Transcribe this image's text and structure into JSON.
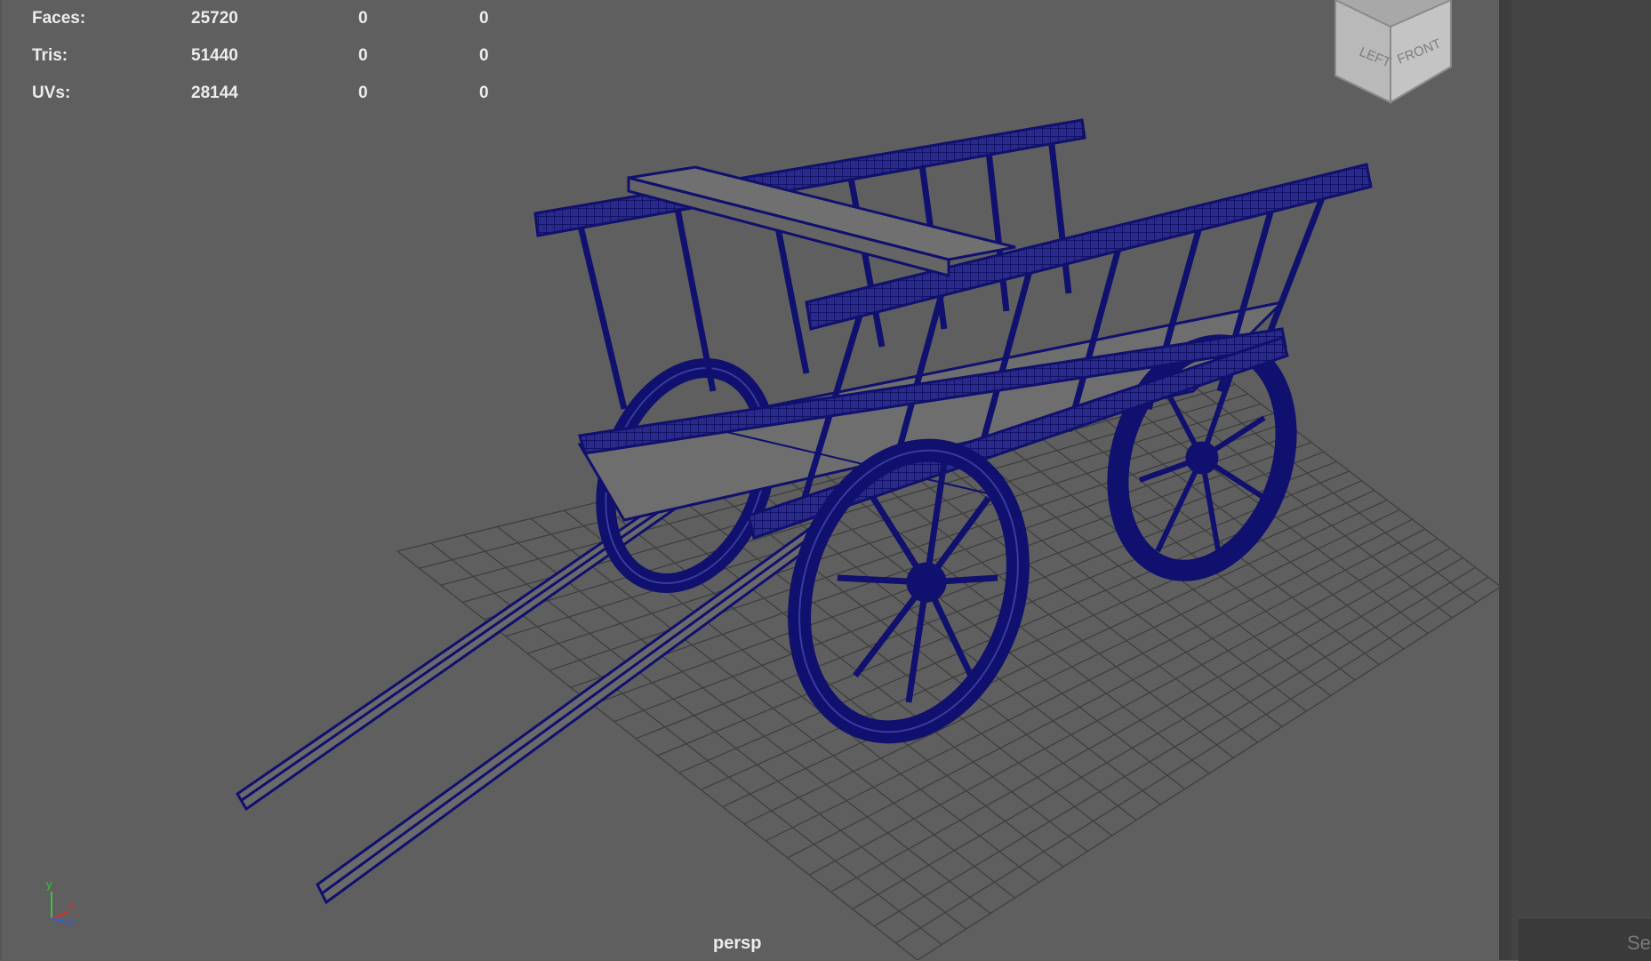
{
  "hud": {
    "rows": [
      {
        "label": "Faces:",
        "values": [
          "25720",
          "0",
          "0"
        ]
      },
      {
        "label": "Tris:",
        "values": [
          "51440",
          "0",
          "0"
        ]
      },
      {
        "label": "UVs:",
        "values": [
          "28144",
          "0",
          "0"
        ]
      }
    ]
  },
  "camera": {
    "name": "persp"
  },
  "view_cube": {
    "left": "LEFT",
    "front": "FRONT"
  },
  "axis_gizmo": {
    "y": "y",
    "x": "x",
    "z": "z"
  },
  "side_panel": {
    "search_text": "Se"
  },
  "colors": {
    "wireframe": "#10106e",
    "mesh_face": "#6f6f6f",
    "grid": "#3d3d3d",
    "viewport_bg": "#5f5f5f"
  },
  "icons": [
    "view-cube-icon",
    "axis-gizmo-icon"
  ]
}
